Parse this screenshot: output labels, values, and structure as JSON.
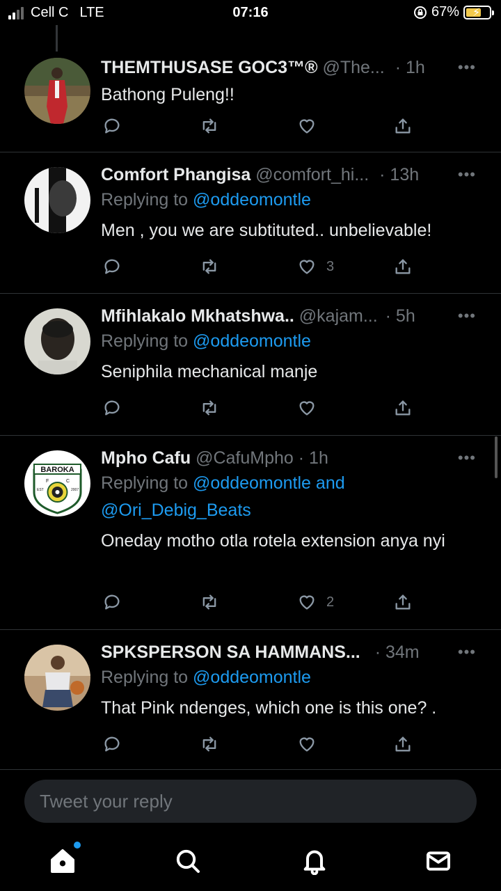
{
  "status_bar": {
    "carrier": "Cell C",
    "network": "LTE",
    "time": "07:16",
    "battery": "67%",
    "battery_level": 0.67,
    "battery_color": "#f2c94c"
  },
  "colors": {
    "accent": "#1d9bf0",
    "background": "#000000",
    "muted": "#71767b"
  },
  "tweets": [
    {
      "name": "THEMTHUSASE GOC3™®",
      "handle": "@The...",
      "time": "· 1h",
      "reply_prefix": "",
      "mentions": "",
      "text": "Bathong Puleng!!",
      "likes": ""
    },
    {
      "name": "Comfort Phangisa",
      "handle": "@comfort_hi...",
      "time": "· 13h",
      "reply_prefix": "Replying to",
      "mentions": "@oddeomontle",
      "text": "Men , you we are subtituted.. unbelievable!",
      "likes": "3"
    },
    {
      "name": "Mfihlakalo Mkhatshwa..",
      "handle": "@kajam...",
      "time": "· 5h",
      "reply_prefix": "Replying to",
      "mentions": "@oddeomontle",
      "text": "Seniphila mechanical manje",
      "likes": ""
    },
    {
      "name": "Mpho Cafu",
      "handle": "@CafuMpho",
      "time": "· 1h",
      "reply_prefix": "Replying to",
      "mentions": "@oddeomontle and @Ori_Debig_Beats",
      "text": "Oneday motho otla rotela extension anya nyi",
      "likes": "2"
    },
    {
      "name": "SPKSPERSON SA HAMMANS...",
      "handle": "",
      "time": "· 34m",
      "reply_prefix": "Replying to",
      "mentions": "@oddeomontle",
      "text": "That Pink ndenges, which one is this one? .",
      "likes": ""
    }
  ],
  "reply_box": {
    "placeholder": "Tweet your reply"
  },
  "logos": {
    "baroka_text": "BAROKA",
    "baroka_f": "F",
    "baroka_c": "C",
    "baroka_est": "EST",
    "baroka_year": "2007"
  }
}
